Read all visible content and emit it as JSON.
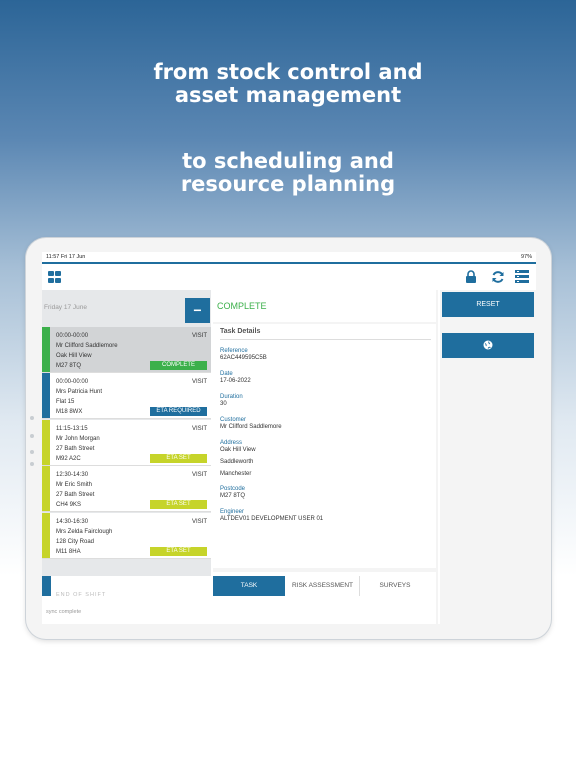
{
  "headline1": {
    "line1": "from stock control and",
    "line2": "asset management"
  },
  "headline2": {
    "line1": "to scheduling and",
    "line2": "resource planning"
  },
  "status": {
    "time": "11:57   Fri 17 Jun",
    "right": "97%"
  },
  "topbar": {
    "grid_icon": "grid-icon",
    "lock_icon": "lock-icon",
    "sync_icon": "refresh-icon",
    "menu_icon": "list-icon"
  },
  "left": {
    "date_header": "Friday 17 June",
    "collapse_label": "−",
    "cards": [
      {
        "time": "00:00-00:00",
        "type": "VISIT",
        "line1": "Mr Clifford Saddlemore",
        "line2": "Oak Hill View",
        "postcode": "M27 8TQ",
        "badge": "COMPLETE",
        "bar_color": "#3cb04b",
        "badge_color": "#3cb04b"
      },
      {
        "time": "00:00-00:00",
        "type": "VISIT",
        "line1": "Mrs Patricia Hunt",
        "line2": "Flat 15",
        "postcode": "M18 8WX",
        "badge": "ETA REQUIRED",
        "bar_color": "#1f6e9e",
        "badge_color": "#1f6e9e"
      },
      {
        "time": "11:15-13:15",
        "type": "VISIT",
        "line1": "Mr John Morgan",
        "line2": "27 Bath Street",
        "postcode": "M92 A2C",
        "badge": "ETA SET",
        "bar_color": "#c6d42a",
        "badge_color": "#c6d42a"
      },
      {
        "time": "12:30-14:30",
        "type": "VISIT",
        "line1": "Mr Eric Smith",
        "line2": "27 Bath Street",
        "postcode": "CH4 9KS",
        "badge": "ETA SET",
        "bar_color": "#c6d42a",
        "badge_color": "#c6d42a"
      },
      {
        "time": "14:30-16:30",
        "type": "VISIT",
        "line1": "Mrs Zelda Fairclough",
        "line2": "128 City Road",
        "postcode": "M11 8HA",
        "badge": "ETA SET",
        "bar_color": "#c6d42a",
        "badge_color": "#c6d42a"
      }
    ],
    "end_text": "END OF SHIFT"
  },
  "middle": {
    "status_title": "COMPLETE",
    "details_title": "Task Details",
    "fields": {
      "reference_label": "Reference",
      "reference_value": "62AC449595C5B",
      "date_label": "Date",
      "date_value": "17-06-2022",
      "duration_label": "Duration",
      "duration_value": "30",
      "customer_label": "Customer",
      "customer_value": "Mr Clifford Saddlemore",
      "address_label": "Address",
      "address_line1": "Oak Hill View",
      "address_line2": "Saddleworth",
      "address_line3": "Manchester",
      "postcode_label": "Postcode",
      "postcode_value": "M27 8TQ",
      "engineer_label": "Engineer",
      "engineer_value": "ALTDEV01 DEVELOPMENT USER 01"
    },
    "tabs": [
      "TASK",
      "RISK ASSESSMENT",
      "SURVEYS"
    ]
  },
  "right": {
    "reset_label": "RESET",
    "globe_icon": "globe-icon"
  },
  "footer": {
    "sync_text": "sync complete"
  }
}
